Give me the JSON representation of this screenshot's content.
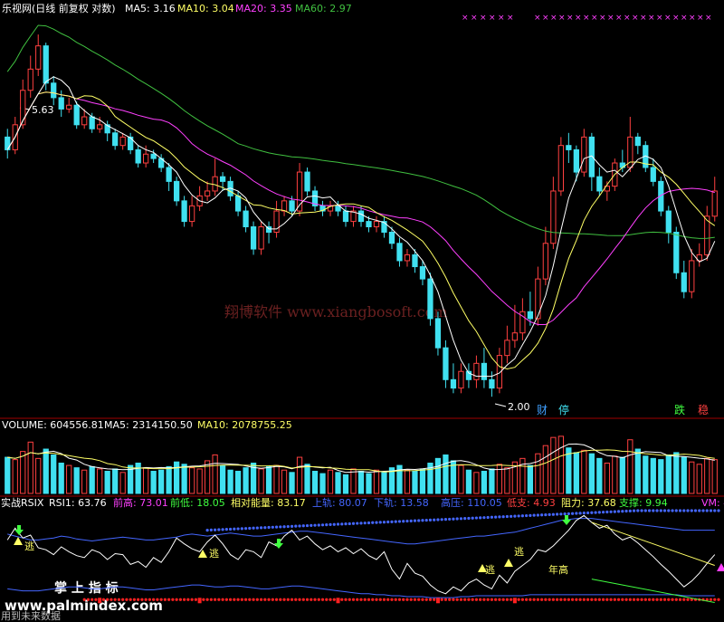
{
  "colors": {
    "up": "#ff4040",
    "down": "#40e0f0",
    "ma5": "#ffffff",
    "ma10": "#ffff66",
    "ma20": "#ff40ff",
    "ma60": "#40c040",
    "cross": "#ff40ff",
    "rsi": "#ffffff",
    "upper": "#4466ff",
    "lower": "#4466ff",
    "support": "#ff2020",
    "resist": "#ffff66",
    "warn": "#ff4040",
    "ok": "#40ff40"
  },
  "price_panel": {
    "title": "乐视网(日线 前复权 对数)",
    "ma_labels": [
      {
        "key": "ma5",
        "text": "MA5: 3.16"
      },
      {
        "key": "ma10",
        "text": "MA10: 3.04"
      },
      {
        "key": "ma20",
        "text": "MA20: 3.35"
      },
      {
        "key": "ma60",
        "text": "MA60: 2.97"
      }
    ],
    "high_marker": "5.63",
    "low_marker": "2.00",
    "signal_a": "财",
    "signal_b": "停",
    "signal_c": "跌",
    "signal_d": "稳",
    "watermark": "翔博软件  www.xiangbosoft.com"
  },
  "volume_panel": {
    "label": "VOLUME: 604556.81",
    "ma5_label": "MA5: 2314150.50",
    "ma10_label": "MA10: 2078755.25"
  },
  "indicator_panel": {
    "name": "实战RSIX",
    "labels": [
      {
        "key": "rsi",
        "text": "RSI1: 63.76"
      },
      {
        "key": "high",
        "text": "前高: 73.01"
      },
      {
        "key": "low",
        "text": "前低: 18.05"
      },
      {
        "key": "energy",
        "text": "相对能量: 83.17"
      },
      {
        "key": "upper",
        "text": "上轨: 80.07"
      },
      {
        "key": "lower",
        "text": "下轨: 13.58"
      },
      {
        "key": "press",
        "text": "高压: 110.05"
      },
      {
        "key": "lowsup",
        "text": "低支: 4.93"
      },
      {
        "key": "resist",
        "text": "阻力: 37.68"
      },
      {
        "key": "support",
        "text": "支撑: 9.94"
      },
      {
        "key": "vm",
        "text": "VM: 4"
      }
    ],
    "escape_label": "逃",
    "year_high_label": "年高",
    "watermark_cn": "掌 上 指 标",
    "watermark_url": "www.palmindex.com",
    "footer_text": "用到未来数据"
  },
  "chart_data": {
    "type": "candlestick",
    "scale": "log",
    "price_range": [
      1.9,
      5.9
    ],
    "candles": [
      [
        4.2,
        4.05,
        4.3,
        3.95
      ],
      [
        4.05,
        4.35,
        4.45,
        4.0
      ],
      [
        4.35,
        4.8,
        4.95,
        4.3
      ],
      [
        4.8,
        5.1,
        5.3,
        4.7
      ],
      [
        5.1,
        5.45,
        5.63,
        5.0
      ],
      [
        5.45,
        4.9,
        5.5,
        4.8
      ],
      [
        4.9,
        4.7,
        5.0,
        4.6
      ],
      [
        4.7,
        4.55,
        4.8,
        4.45
      ],
      [
        4.55,
        4.6,
        4.7,
        4.5
      ],
      [
        4.6,
        4.35,
        4.65,
        4.3
      ],
      [
        4.35,
        4.45,
        4.55,
        4.3
      ],
      [
        4.45,
        4.3,
        4.5,
        4.25
      ],
      [
        4.3,
        4.35,
        4.45,
        4.25
      ],
      [
        4.35,
        4.25,
        4.4,
        4.15
      ],
      [
        4.25,
        4.1,
        4.3,
        4.05
      ],
      [
        4.1,
        4.2,
        4.25,
        4.05
      ],
      [
        4.2,
        4.05,
        4.25,
        4.0
      ],
      [
        4.05,
        3.9,
        4.1,
        3.85
      ],
      [
        3.9,
        4.0,
        4.1,
        3.85
      ],
      [
        4.0,
        3.95,
        4.05,
        3.9
      ],
      [
        3.95,
        3.85,
        4.0,
        3.8
      ],
      [
        3.85,
        3.7,
        3.9,
        3.6
      ],
      [
        3.7,
        3.5,
        3.75,
        3.45
      ],
      [
        3.5,
        3.3,
        3.55,
        3.25
      ],
      [
        3.3,
        3.45,
        3.55,
        3.25
      ],
      [
        3.45,
        3.55,
        3.65,
        3.4
      ],
      [
        3.55,
        3.6,
        3.7,
        3.5
      ],
      [
        3.6,
        3.75,
        3.95,
        3.55
      ],
      [
        3.75,
        3.7,
        3.8,
        3.6
      ],
      [
        3.7,
        3.55,
        3.75,
        3.5
      ],
      [
        3.55,
        3.4,
        3.6,
        3.35
      ],
      [
        3.4,
        3.25,
        3.45,
        3.2
      ],
      [
        3.25,
        3.05,
        3.3,
        3.0
      ],
      [
        3.05,
        3.25,
        3.3,
        3.0
      ],
      [
        3.25,
        3.2,
        3.3,
        3.1
      ],
      [
        3.2,
        3.4,
        3.5,
        3.15
      ],
      [
        3.4,
        3.5,
        3.55,
        3.35
      ],
      [
        3.5,
        3.4,
        3.55,
        3.35
      ],
      [
        3.4,
        3.8,
        3.9,
        3.35
      ],
      [
        3.8,
        3.6,
        3.85,
        3.55
      ],
      [
        3.6,
        3.45,
        3.65,
        3.4
      ],
      [
        3.45,
        3.4,
        3.5,
        3.35
      ],
      [
        3.4,
        3.45,
        3.5,
        3.35
      ],
      [
        3.45,
        3.4,
        3.5,
        3.35
      ],
      [
        3.4,
        3.3,
        3.45,
        3.25
      ],
      [
        3.3,
        3.4,
        3.45,
        3.25
      ],
      [
        3.4,
        3.3,
        3.45,
        3.25
      ],
      [
        3.3,
        3.25,
        3.35,
        3.2
      ],
      [
        3.25,
        3.3,
        3.35,
        3.2
      ],
      [
        3.3,
        3.2,
        3.35,
        3.15
      ],
      [
        3.2,
        3.1,
        3.25,
        3.05
      ],
      [
        3.1,
        2.95,
        3.15,
        2.9
      ],
      [
        2.95,
        3.0,
        3.05,
        2.9
      ],
      [
        3.0,
        2.9,
        3.05,
        2.85
      ],
      [
        2.9,
        2.8,
        2.95,
        2.75
      ],
      [
        2.8,
        2.5,
        2.85,
        2.45
      ],
      [
        2.5,
        2.3,
        2.55,
        2.25
      ],
      [
        2.3,
        2.1,
        2.35,
        2.05
      ],
      [
        2.1,
        2.05,
        2.2,
        2.02
      ],
      [
        2.05,
        2.15,
        2.2,
        2.02
      ],
      [
        2.15,
        2.1,
        2.2,
        2.05
      ],
      [
        2.1,
        2.2,
        2.25,
        2.05
      ],
      [
        2.2,
        2.1,
        2.3,
        2.05
      ],
      [
        2.1,
        2.05,
        2.15,
        2.0
      ],
      [
        2.05,
        2.25,
        2.3,
        2.02
      ],
      [
        2.25,
        2.35,
        2.45,
        2.2
      ],
      [
        2.35,
        2.4,
        2.6,
        2.3
      ],
      [
        2.4,
        2.55,
        2.65,
        2.35
      ],
      [
        2.55,
        2.5,
        2.7,
        2.45
      ],
      [
        2.5,
        2.8,
        2.9,
        2.45
      ],
      [
        2.8,
        3.1,
        3.25,
        2.75
      ],
      [
        3.1,
        3.6,
        3.75,
        3.05
      ],
      [
        3.6,
        4.1,
        4.2,
        3.55
      ],
      [
        4.1,
        4.05,
        4.25,
        3.9
      ],
      [
        4.05,
        3.8,
        4.1,
        3.7
      ],
      [
        3.8,
        4.2,
        4.3,
        3.75
      ],
      [
        4.2,
        3.75,
        4.25,
        3.6
      ],
      [
        3.75,
        3.6,
        3.85,
        3.55
      ],
      [
        3.6,
        3.65,
        3.7,
        3.5
      ],
      [
        3.65,
        3.9,
        3.95,
        3.6
      ],
      [
        3.9,
        3.85,
        4.05,
        3.8
      ],
      [
        3.85,
        4.2,
        4.45,
        3.8
      ],
      [
        4.2,
        4.1,
        4.25,
        4.0
      ],
      [
        4.1,
        3.85,
        4.15,
        3.8
      ],
      [
        3.85,
        3.7,
        3.95,
        3.65
      ],
      [
        3.7,
        3.4,
        3.75,
        3.35
      ],
      [
        3.4,
        3.2,
        3.45,
        3.1
      ],
      [
        3.2,
        2.85,
        3.25,
        2.8
      ],
      [
        2.85,
        2.7,
        2.95,
        2.65
      ],
      [
        2.7,
        2.95,
        3.05,
        2.65
      ],
      [
        2.95,
        3.0,
        3.1,
        2.9
      ],
      [
        3.0,
        3.35,
        3.45,
        2.95
      ],
      [
        3.35,
        3.6,
        3.75,
        3.3
      ]
    ],
    "volume": [
      3.1,
      2.9,
      3.6,
      4.4,
      3.0,
      3.8,
      3.3,
      2.6,
      2.4,
      2.2,
      2.0,
      2.3,
      2.1,
      1.9,
      2.1,
      1.8,
      2.4,
      2.6,
      2.2,
      1.9,
      2.0,
      2.3,
      2.7,
      2.5,
      2.2,
      2.1,
      2.8,
      3.3,
      2.4,
      2.0,
      1.9,
      2.2,
      2.6,
      2.1,
      2.3,
      2.4,
      2.0,
      1.8,
      3.1,
      2.5,
      1.9,
      1.7,
      2.0,
      1.8,
      1.6,
      2.1,
      1.9,
      1.7,
      2.0,
      1.8,
      2.2,
      2.4,
      2.0,
      1.9,
      2.1,
      2.6,
      3.0,
      3.3,
      2.8,
      2.4,
      2.0,
      1.8,
      1.9,
      2.1,
      2.5,
      2.2,
      2.7,
      3.0,
      2.4,
      3.4,
      4.1,
      4.8,
      4.9,
      3.9,
      3.5,
      3.7,
      3.4,
      3.0,
      2.6,
      3.2,
      3.1,
      4.6,
      3.8,
      3.2,
      3.0,
      2.9,
      3.3,
      3.5,
      3.1,
      2.7,
      2.5,
      3.0,
      2.9
    ],
    "volume_max": 5.2,
    "rsi": [
      70,
      82,
      72,
      75,
      62,
      60,
      55,
      63,
      58,
      54,
      52,
      60,
      57,
      50,
      56,
      55,
      45,
      48,
      42,
      52,
      47,
      58,
      72,
      66,
      61,
      58,
      68,
      75,
      66,
      55,
      50,
      60,
      58,
      52,
      68,
      64,
      74,
      80,
      70,
      74,
      66,
      60,
      64,
      58,
      62,
      56,
      61,
      54,
      50,
      58,
      40,
      30,
      46,
      36,
      33,
      24,
      18,
      15,
      22,
      18,
      26,
      30,
      24,
      20,
      34,
      26,
      38,
      44,
      50,
      60,
      58,
      64,
      72,
      80,
      90,
      95,
      88,
      82,
      85,
      76,
      70,
      73,
      67,
      60,
      53,
      45,
      38,
      30,
      22,
      28,
      36,
      46,
      55
    ],
    "upper": [
      76,
      74,
      72,
      70,
      70,
      71,
      72,
      74,
      73,
      71,
      70,
      69,
      70,
      71,
      72,
      73,
      72,
      71,
      70,
      70,
      71,
      72,
      73,
      75,
      76,
      75,
      74,
      75,
      76,
      77,
      76,
      75,
      74,
      74,
      75,
      76,
      77,
      78,
      79,
      79,
      78,
      77,
      76,
      75,
      74,
      73,
      72,
      71,
      70,
      69,
      68,
      67,
      66,
      66,
      67,
      68,
      69,
      70,
      71,
      72,
      73,
      74,
      74,
      75,
      76,
      77,
      78,
      80,
      82,
      84,
      86,
      88,
      90,
      91,
      92,
      92,
      92,
      91,
      90,
      89,
      88,
      87,
      86,
      85,
      84,
      83,
      82,
      81,
      80,
      80,
      80,
      80,
      80
    ],
    "lower": [
      20,
      19,
      18,
      18,
      18,
      19,
      20,
      21,
      22,
      22,
      21,
      20,
      20,
      21,
      22,
      22,
      21,
      20,
      19,
      19,
      20,
      21,
      22,
      23,
      24,
      24,
      23,
      22,
      22,
      23,
      23,
      22,
      21,
      20,
      20,
      21,
      22,
      23,
      23,
      22,
      21,
      20,
      19,
      18,
      17,
      16,
      15,
      15,
      14,
      14,
      13,
      13,
      12,
      12,
      12,
      11,
      11,
      11,
      11,
      12,
      12,
      13,
      13,
      13,
      13,
      13,
      13,
      13,
      14,
      14,
      14,
      14,
      14,
      14,
      14,
      14,
      14,
      14,
      14,
      14,
      14,
      14,
      14,
      14,
      14,
      14,
      14,
      14,
      13,
      13,
      13,
      13,
      13
    ],
    "rsi_range": [
      0,
      100
    ],
    "yellow_line": [
      [
        76,
        88
      ],
      [
        92,
        44
      ]
    ],
    "green_line": [
      [
        76,
        30
      ],
      [
        92,
        6
      ]
    ]
  }
}
